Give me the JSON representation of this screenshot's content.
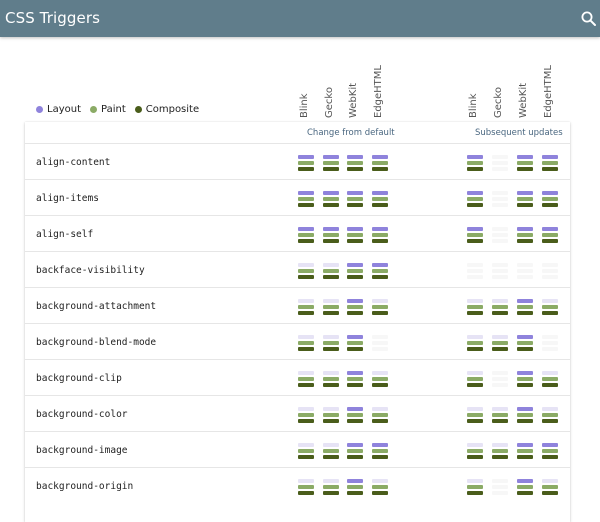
{
  "header": {
    "title": "CSS Triggers",
    "search_icon": "search-icon"
  },
  "legend": [
    {
      "label": "Layout",
      "color": "#8f83dc"
    },
    {
      "label": "Paint",
      "color": "#8bab66"
    },
    {
      "label": "Composite",
      "color": "#4a5d1b"
    }
  ],
  "engines": [
    "Blink",
    "Gecko",
    "WebKit",
    "EdgeHTML"
  ],
  "groups": [
    "Change from default",
    "Subsequent updates"
  ],
  "colors": {
    "layout": "#8f83dc",
    "paint": "#8bab66",
    "composite": "#4a5d1b",
    "inactive_layout": "#e6e3f5",
    "inactive_paint": "#e3ebd8",
    "inactive_composite": "#dde2d0"
  },
  "properties": [
    {
      "name": "align-content",
      "change": [
        "LPC",
        "LPC",
        "LPC",
        "LPC"
      ],
      "subsequent": [
        "LPC",
        "",
        "LPC",
        "LPC"
      ]
    },
    {
      "name": "align-items",
      "change": [
        "LPC",
        "LPC",
        "LPC",
        "LPC"
      ],
      "subsequent": [
        "LPC",
        "",
        "LPC",
        "LPC"
      ]
    },
    {
      "name": "align-self",
      "change": [
        "LPC",
        "LPC",
        "LPC",
        "LPC"
      ],
      "subsequent": [
        "LPC",
        "",
        "LPC",
        "LPC"
      ]
    },
    {
      "name": "backface-visibility",
      "change": [
        "PC",
        "PC",
        "LPC",
        "LPC"
      ],
      "subsequent": [
        "",
        "",
        "",
        ""
      ]
    },
    {
      "name": "background-attachment",
      "change": [
        "PC",
        "PC",
        "LPC",
        "PC"
      ],
      "subsequent": [
        "PC",
        "PC",
        "LPC",
        "PC"
      ]
    },
    {
      "name": "background-blend-mode",
      "change": [
        "PC",
        "PC",
        "LPC",
        ""
      ],
      "subsequent": [
        "PC",
        "PC",
        "LPC",
        ""
      ]
    },
    {
      "name": "background-clip",
      "change": [
        "PC",
        "PC",
        "LPC",
        "PC"
      ],
      "subsequent": [
        "PC",
        "",
        "LPC",
        "PC"
      ]
    },
    {
      "name": "background-color",
      "change": [
        "PC",
        "PC",
        "LPC",
        "PC"
      ],
      "subsequent": [
        "PC",
        "PC",
        "LPC",
        "PC"
      ]
    },
    {
      "name": "background-image",
      "change": [
        "PC",
        "PC",
        "LPC",
        "LPC"
      ],
      "subsequent": [
        "PC",
        "PC",
        "LPC",
        "LPC"
      ]
    },
    {
      "name": "background-origin",
      "change": [
        "PC",
        "PC",
        "LPC",
        "PC"
      ],
      "subsequent": [
        "PC",
        "",
        "LPC",
        "PC"
      ]
    }
  ]
}
